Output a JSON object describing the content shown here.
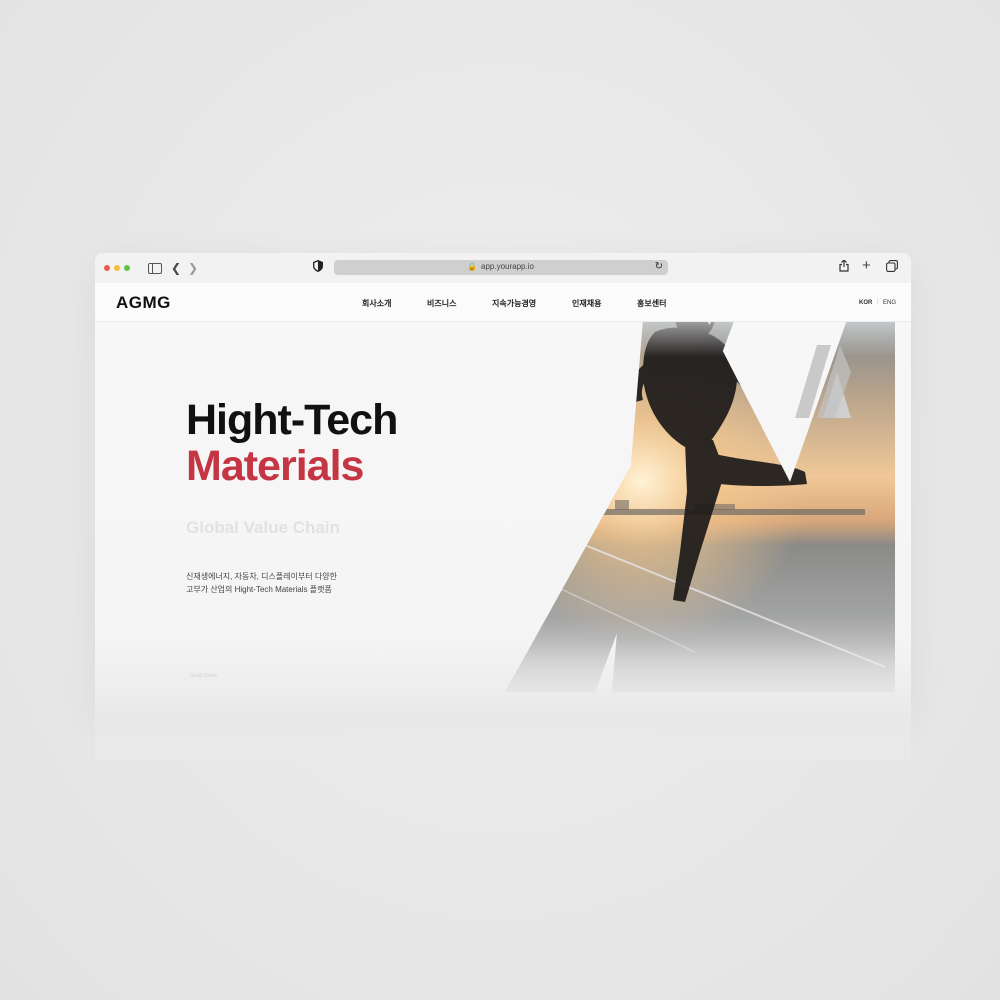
{
  "browser": {
    "url": "app.yourapp.io"
  },
  "site": {
    "logo": "AGMG",
    "nav": [
      "회사소개",
      "비즈니스",
      "지속가능경영",
      "인재채용",
      "홍보센터"
    ],
    "lang": {
      "kor": "KOR",
      "separator": "|",
      "eng": "ENG"
    }
  },
  "hero": {
    "title_line1": "Hight-Tech",
    "title_line2": "Materials",
    "subtitle": "Global Value Chain",
    "description_line1": "신재생에너지, 자동차, 디스플레이부터 다양한",
    "description_line2": "고부가 산업의 Hight-Tech Materials 플랫폼",
    "scroll_label": "Scroll Down"
  },
  "colors": {
    "accent_red": "#c53644",
    "title_black": "#111111",
    "subtitle_gray": "#e2e2e2"
  }
}
